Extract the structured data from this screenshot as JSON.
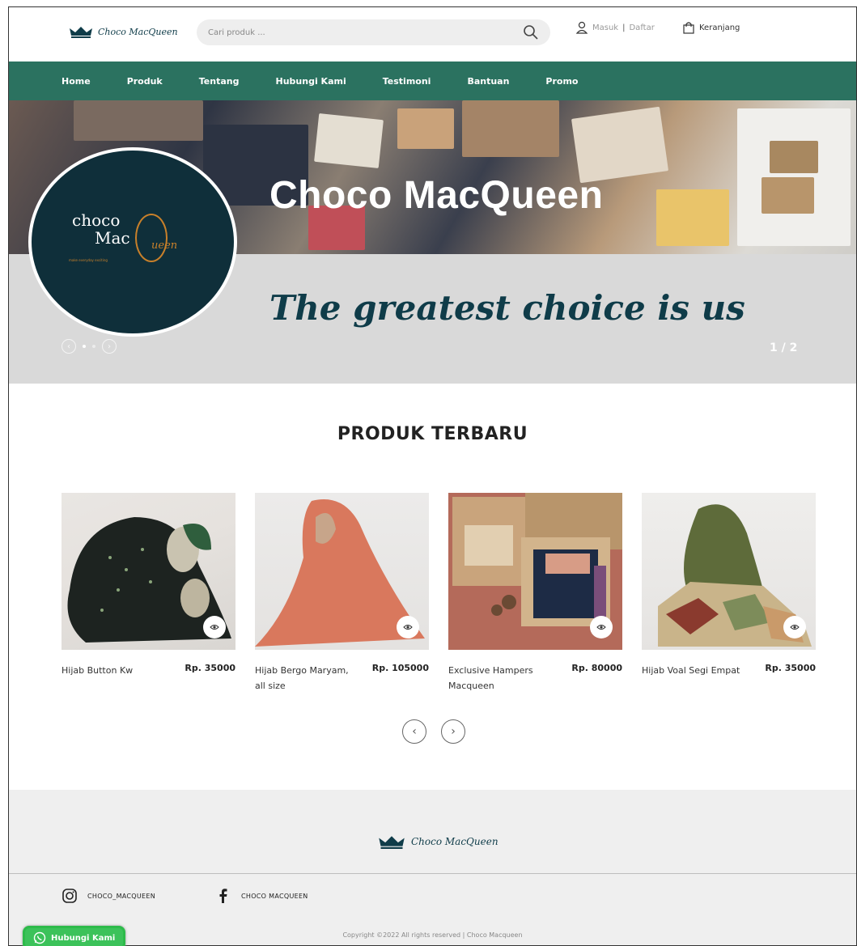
{
  "header": {
    "brand": "Choco MacQueen",
    "search_placeholder": "Cari produk ...",
    "login_label": "Masuk",
    "separator": "|",
    "register_label": "Daftar",
    "cart_label": "Keranjang"
  },
  "nav": {
    "items": [
      "Home",
      "Produk",
      "Tentang",
      "Hubungi Kami",
      "Testimoni",
      "Bantuan",
      "Promo"
    ]
  },
  "hero": {
    "title": "Choco MacQueen",
    "tagline": "The greatest choice is us",
    "logo_line1": "choco",
    "logo_line2": "Mac",
    "logo_line3": "ueen",
    "logo_line4": "make everyday exciting",
    "slide_counter": "1 / 2",
    "prev_icon": "‹",
    "next_icon": "›"
  },
  "products": {
    "title": "PRODUK TERBARU",
    "items": [
      {
        "name": "Hijab Button Kw",
        "price": "Rp. 35000"
      },
      {
        "name": "Hijab Bergo Maryam, all size",
        "price": "Rp. 105000"
      },
      {
        "name": "Exclusive Hampers Macqueen",
        "price": "Rp. 80000"
      },
      {
        "name": "Hijab Voal Segi Empat",
        "price": "Rp. 35000"
      }
    ],
    "prev": "‹",
    "next": "›"
  },
  "footer": {
    "brand": "Choco MacQueen",
    "instagram": "CHOCO_MACQUEEN",
    "facebook": "CHOCO MACQUEEN",
    "copyright": "Copyright ©2022 All rights reserved | Choco Macqueen",
    "whatsapp_label": "Hubungi Kami"
  },
  "colors": {
    "nav_green": "#2b7260",
    "brand_navy": "#0f3c49",
    "whatsapp_green": "#3cc25a"
  }
}
